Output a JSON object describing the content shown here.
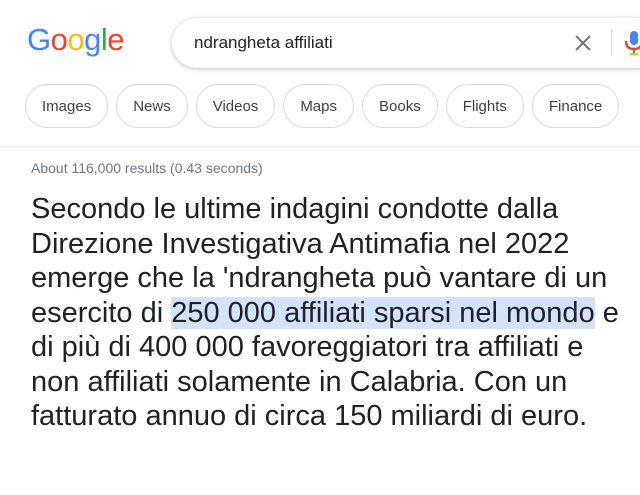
{
  "logo": {
    "letters": [
      "G",
      "o",
      "o",
      "g",
      "l",
      "e"
    ],
    "colors": [
      "#4285F4",
      "#EA4335",
      "#FBBC05",
      "#4285F4",
      "#34A853",
      "#EA4335"
    ]
  },
  "search": {
    "query": "ndrangheta affiliati",
    "placeholder": ""
  },
  "chips": [
    "Images",
    "News",
    "Videos",
    "Maps",
    "Books",
    "Flights",
    "Finance"
  ],
  "results_stats": "About 116,000 results (0.43 seconds)",
  "snippet": {
    "before": "Secondo le ultime indagini condotte dalla Direzione Investigativa Antimafia nel 2022 emerge che la 'ndrangheta può vantare di un esercito di ",
    "highlight": "250 000 affiliati sparsi nel mondo",
    "after": " e di più di 400 000 favoreggiatori tra affiliati e non affiliati solamente in Calabria. Con un fatturato annuo di circa 150 miliardi di euro."
  },
  "colors": {
    "highlight": "#d3e3fd",
    "chip_border": "#dadce0",
    "text": "#202124",
    "muted": "#70757a"
  },
  "icons": {
    "clear": "close-icon",
    "voice": "mic-icon"
  }
}
